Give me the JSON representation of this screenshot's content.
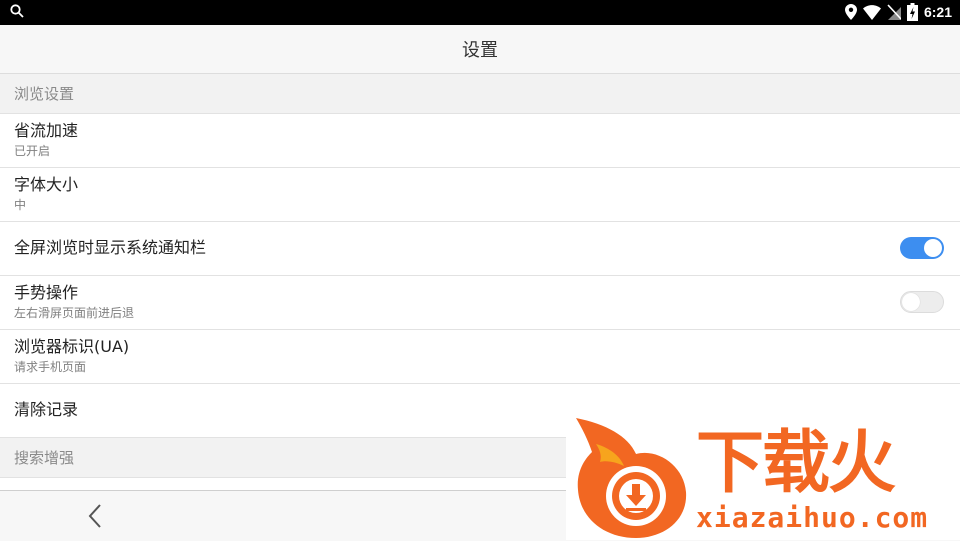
{
  "status_bar": {
    "icons": [
      "search-icon",
      "location-icon",
      "wifi-icon",
      "no-sim-icon",
      "battery-charging-icon"
    ],
    "time": "6:21"
  },
  "title_bar": {
    "title": "设置"
  },
  "sections": [
    {
      "header": "浏览设置",
      "items": [
        {
          "title": "省流加速",
          "subtitle": "已开启"
        },
        {
          "title": "字体大小",
          "subtitle": "中"
        },
        {
          "title": "全屏浏览时显示系统通知栏",
          "toggle": "on"
        },
        {
          "title": "手势操作",
          "subtitle": "左右滑屏页面前进后退",
          "toggle": "off"
        },
        {
          "title": "浏览器标识(UA)",
          "subtitle": "请求手机页面"
        },
        {
          "title": "清除记录"
        }
      ]
    },
    {
      "header": "搜索增强"
    }
  ],
  "bottom_bar": {
    "icons": [
      "back-chevron-icon"
    ]
  },
  "watermark": {
    "brand": "下载火",
    "domain": "xiazaihuo.com",
    "accent_color": "#f26722"
  }
}
